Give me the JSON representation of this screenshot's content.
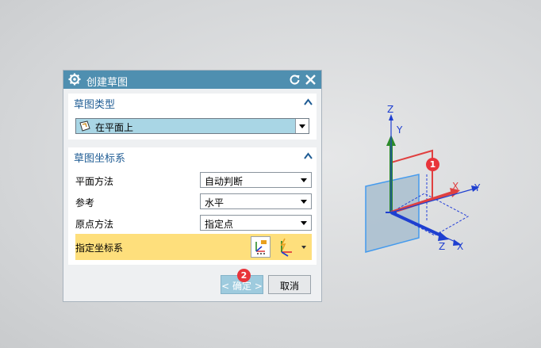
{
  "dialog": {
    "title": "创建草图",
    "icons": {
      "gear": "gear-icon",
      "reset": "reset-icon",
      "close": "close-icon"
    }
  },
  "sketch_type": {
    "header": "草图类型",
    "selected": "在平面上"
  },
  "sketch_csys": {
    "header": "草图坐标系",
    "plane_method_label": "平面方法",
    "plane_method_value": "自动判断",
    "reference_label": "参考",
    "reference_value": "水平",
    "origin_method_label": "原点方法",
    "origin_method_value": "指定点",
    "specify_csys_label": "指定坐标系"
  },
  "buttons": {
    "ok": "< 确定 >",
    "cancel": "取消"
  },
  "annotations": {
    "badge1": "1",
    "badge2": "2"
  },
  "axes": {
    "z_top": "Z",
    "y_vertical": "Y",
    "x_red": "X",
    "y_blue": "Y",
    "z_bottom": "Z",
    "x_bottom": "X"
  },
  "colors": {
    "title_bar": "#4f8fb0",
    "section_header_text": "#1f5c94",
    "selected_field": "#a9d6e5",
    "highlight_row": "#fedf7c",
    "ok_button": "#9ecbde",
    "badge": "#e8343a",
    "axis_blue": "#1e3fd0",
    "axis_green": "#2b8a2b",
    "axis_red": "#e04040"
  }
}
